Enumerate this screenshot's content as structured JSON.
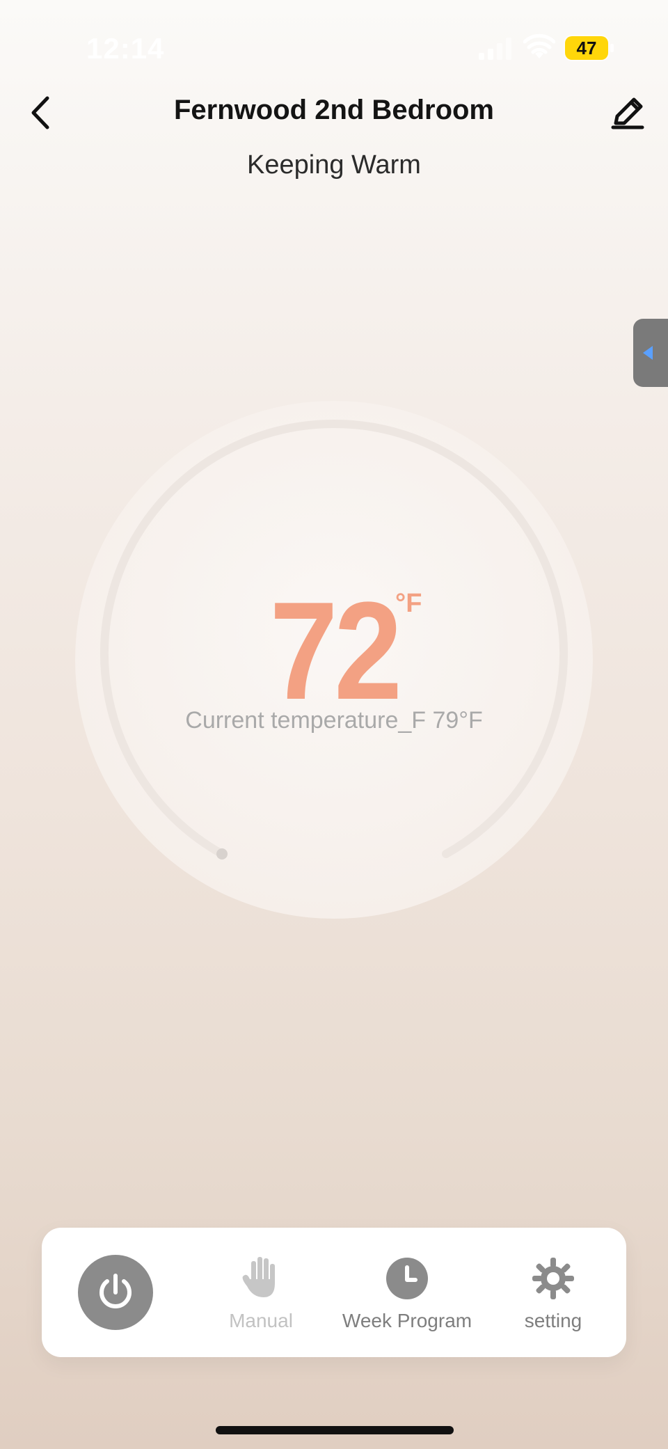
{
  "status_bar": {
    "time": "12:14",
    "battery": "47"
  },
  "header": {
    "title": "Fernwood 2nd Bedroom",
    "status": "Keeping Warm"
  },
  "thermostat": {
    "setpoint": "72",
    "unit": "°F",
    "current_label": "Current temperature_F 79°F"
  },
  "bottom_nav": {
    "items": [
      {
        "label": "Manual"
      },
      {
        "label": "Week Program"
      },
      {
        "label": "setting"
      }
    ]
  },
  "colors": {
    "accent": "#f3a183",
    "icon_gray": "#8b8b8b",
    "side_tab_arrow": "#5aa0ff"
  },
  "icons": {
    "back": "chevron-left-icon",
    "edit": "pencil-icon",
    "power": "power-icon",
    "manual": "hand-icon",
    "week_program": "clock-icon",
    "setting": "gear-icon"
  }
}
